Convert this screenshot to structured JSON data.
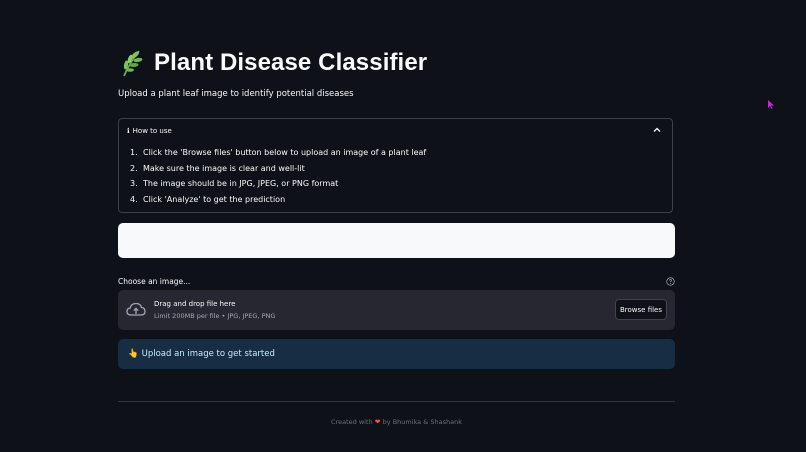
{
  "header": {
    "title": "Plant Disease Classifier",
    "subtitle": "Upload a plant leaf image to identify potential diseases",
    "title_icon": "herb-icon"
  },
  "how_to": {
    "info_glyph": "ℹ",
    "title": "How to use",
    "steps": [
      {
        "num": "1.",
        "text": "Click the 'Browse files' button below to upload an image of a plant leaf"
      },
      {
        "num": "2.",
        "text": "Make sure the image is clear and well-lit"
      },
      {
        "num": "3.",
        "text": "The image should be in JPG, JPEG, or PNG format"
      },
      {
        "num": "4.",
        "text": "Click 'Analyze' to get the prediction"
      }
    ]
  },
  "uploader": {
    "label": "Choose an image...",
    "drag_text": "Drag and drop file here",
    "limit_text": "Limit 200MB per file • JPG, JPEG, PNG",
    "browse_label": "Browse files"
  },
  "info": {
    "emoji": "👆",
    "text": "Upload an image to get started"
  },
  "footer": {
    "prefix": "Created with",
    "heart": "❤",
    "suffix": "by Bhumika & Shashank"
  },
  "colors": {
    "background": "#0e1117",
    "dropzone": "#262730",
    "info_bg": "#172d43",
    "info_text": "#c7ebff",
    "accent": "#ff4b4b"
  }
}
